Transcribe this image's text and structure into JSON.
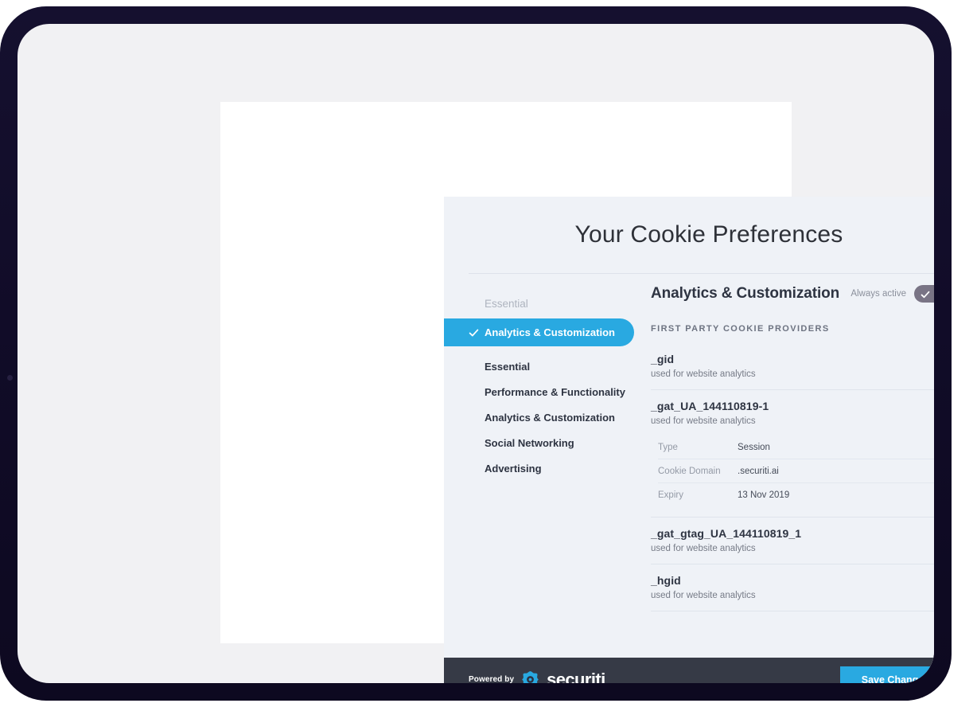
{
  "modal": {
    "title": "Your Cookie Preferences"
  },
  "sidebar": {
    "items": [
      {
        "label": "Essential",
        "state": "muted"
      },
      {
        "label": "Analytics & Customization",
        "state": "active"
      },
      {
        "label": "Essential",
        "state": "normal"
      },
      {
        "label": "Performance & Functionality",
        "state": "normal"
      },
      {
        "label": "Analytics & Customization",
        "state": "normal"
      },
      {
        "label": "Social Networking",
        "state": "normal"
      },
      {
        "label": "Advertising",
        "state": "normal"
      }
    ]
  },
  "content": {
    "category_title": "Analytics & Customization",
    "toggle_label": "Always active",
    "toggle_state": "on",
    "providers_label": "FIRST PARTY COOKIE PROVIDERS",
    "cookies": [
      {
        "name": "_gid",
        "description": "used for website analytics",
        "expanded": false,
        "chevron": "chevron-down-icon"
      },
      {
        "name": "_gat_UA_144110819-1",
        "description": "used for website analytics",
        "expanded": true,
        "chevron": "chevron-up-icon",
        "details": [
          {
            "key": "Type",
            "value": "Session"
          },
          {
            "key": "Cookie Domain",
            "value": ".securiti.ai"
          },
          {
            "key": "Expiry",
            "value": "13 Nov 2019"
          }
        ]
      },
      {
        "name": "_gat_gtag_UA_144110819_1",
        "description": "used for website analytics",
        "expanded": false,
        "chevron": "chevron-down-icon"
      },
      {
        "name": "_hgid",
        "description": "used for website analytics",
        "expanded": false,
        "chevron": "chevron-down-icon"
      }
    ]
  },
  "footer": {
    "powered_by": "Powered by",
    "brand": "securiti",
    "save_label": "Save Changes"
  },
  "colors": {
    "accent": "#29a9e1",
    "modal_bg": "#eff2f7",
    "footer_bg": "#363a46",
    "device_frame": "#110c28",
    "toggle_track": "#797485"
  }
}
